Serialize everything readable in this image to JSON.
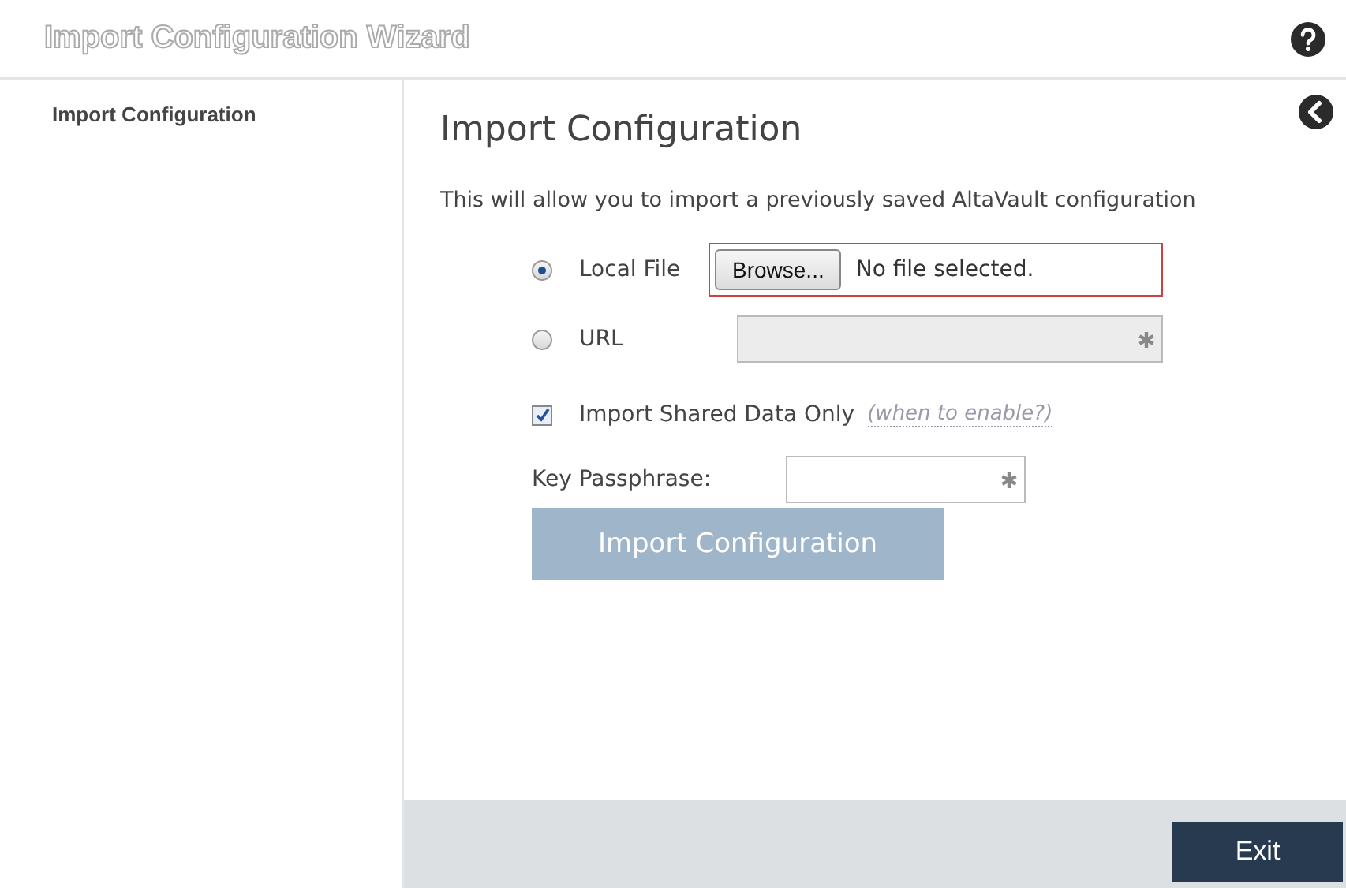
{
  "window": {
    "title": "Import Configuration Wizard"
  },
  "sidebar": {
    "items": [
      {
        "label": "Import Configuration",
        "selected": true
      }
    ]
  },
  "page": {
    "heading": "Import Configuration",
    "description": "This will allow you to import a previously saved AltaVault configuration",
    "source_options": [
      {
        "kind": "file",
        "label": "Local File",
        "selected": true,
        "button": "Browse...",
        "status": "No file selected.",
        "error": true
      },
      {
        "kind": "url",
        "label": "URL",
        "selected": false,
        "disabled": true,
        "required": true
      }
    ],
    "shared_only": {
      "label": "Import Shared Data Only",
      "checked": true,
      "help_link": "(when to enable?)"
    },
    "passphrase": {
      "label": "Key Passphrase:",
      "required": true
    },
    "submit": {
      "label": "Import Configuration",
      "disabled": true
    }
  },
  "footer": {
    "buttons": [
      "Exit"
    ]
  }
}
